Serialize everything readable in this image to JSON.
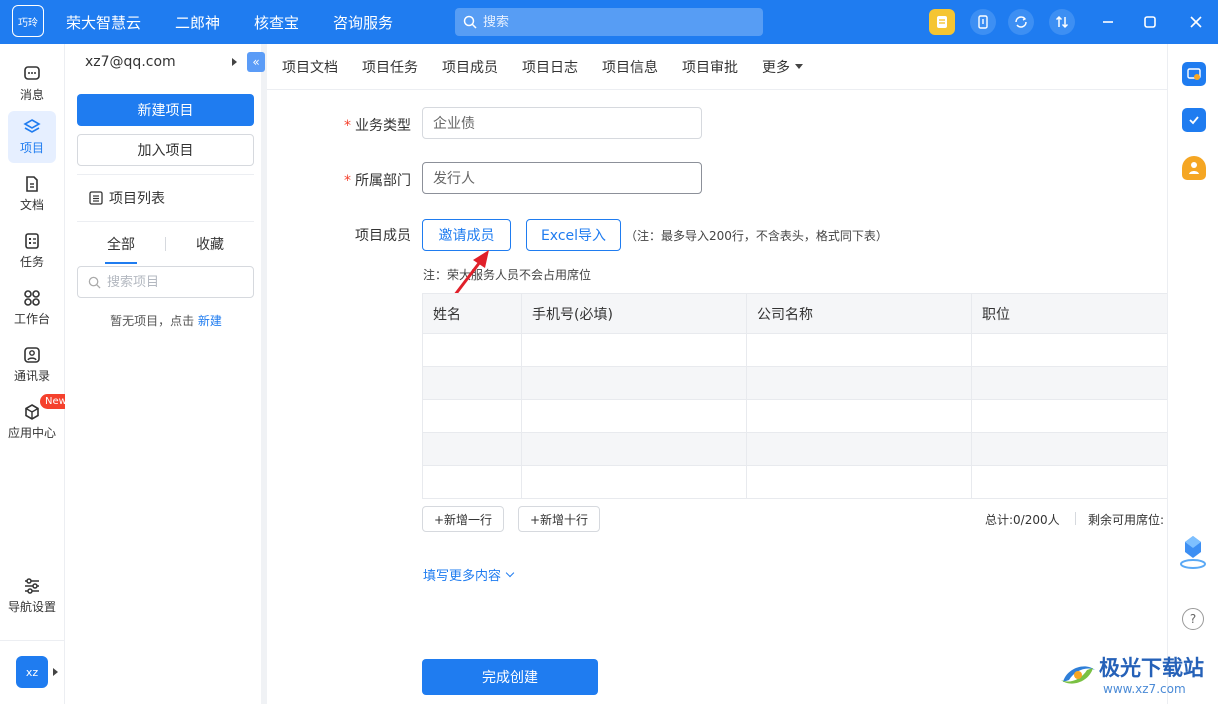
{
  "app": {
    "logo_text": "巧玲"
  },
  "topnav": {
    "items": [
      "荣大智慧云",
      "二郎神",
      "核查宝",
      "咨询服务"
    ]
  },
  "search": {
    "placeholder": "搜索"
  },
  "rail": {
    "items": [
      {
        "label": "消息",
        "icon": "message-icon"
      },
      {
        "label": "项目",
        "icon": "project-icon",
        "active": true
      },
      {
        "label": "文档",
        "icon": "document-icon"
      },
      {
        "label": "任务",
        "icon": "task-icon"
      },
      {
        "label": "工作台",
        "icon": "workbench-icon"
      },
      {
        "label": "通讯录",
        "icon": "contacts-icon"
      },
      {
        "label": "应用中心",
        "icon": "app-center-icon",
        "badge": "New"
      }
    ],
    "nav_settings": "导航设置",
    "avatar": "xz"
  },
  "sidebar": {
    "account": "xz7@qq.com",
    "new_project": "新建项目",
    "join_project": "加入项目",
    "list_title": "项目列表",
    "tabs": [
      "全部",
      "收藏"
    ],
    "search_placeholder": "搜索项目",
    "empty_text": "暂无项目，点击 ",
    "empty_link": "新建"
  },
  "tabs": [
    "项目文档",
    "项目任务",
    "项目成员",
    "项目日志",
    "项目信息",
    "项目审批",
    "更多"
  ],
  "form": {
    "business_type": {
      "label": "业务类型",
      "value": "企业债"
    },
    "department": {
      "label": "所属部门",
      "value": "发行人"
    },
    "members": {
      "label": "项目成员",
      "invite": "邀请成员",
      "excel_import": "Excel导入",
      "import_hint": "（注：最多导入200行，不含表头，格式同下表）",
      "seat_note": "注：荣大服务人员不会占用席位"
    },
    "table": {
      "columns": [
        "姓名",
        "手机号(必填)",
        "公司名称",
        "职位"
      ],
      "row_count": 5
    },
    "add_one_row": "+新增一行",
    "add_ten_rows": "+新增十行",
    "total": "总计:0/200人",
    "remaining": "剩余可用席位:",
    "more_content": "填写更多内容",
    "finish": "完成创建"
  },
  "right_rail": {
    "help": "?"
  },
  "watermark": {
    "title": "极光下载站",
    "url": "www.xz7.com"
  },
  "colors": {
    "primary": "#1f7cf0",
    "required": "#f5412d",
    "arrow": "#e0202a"
  }
}
